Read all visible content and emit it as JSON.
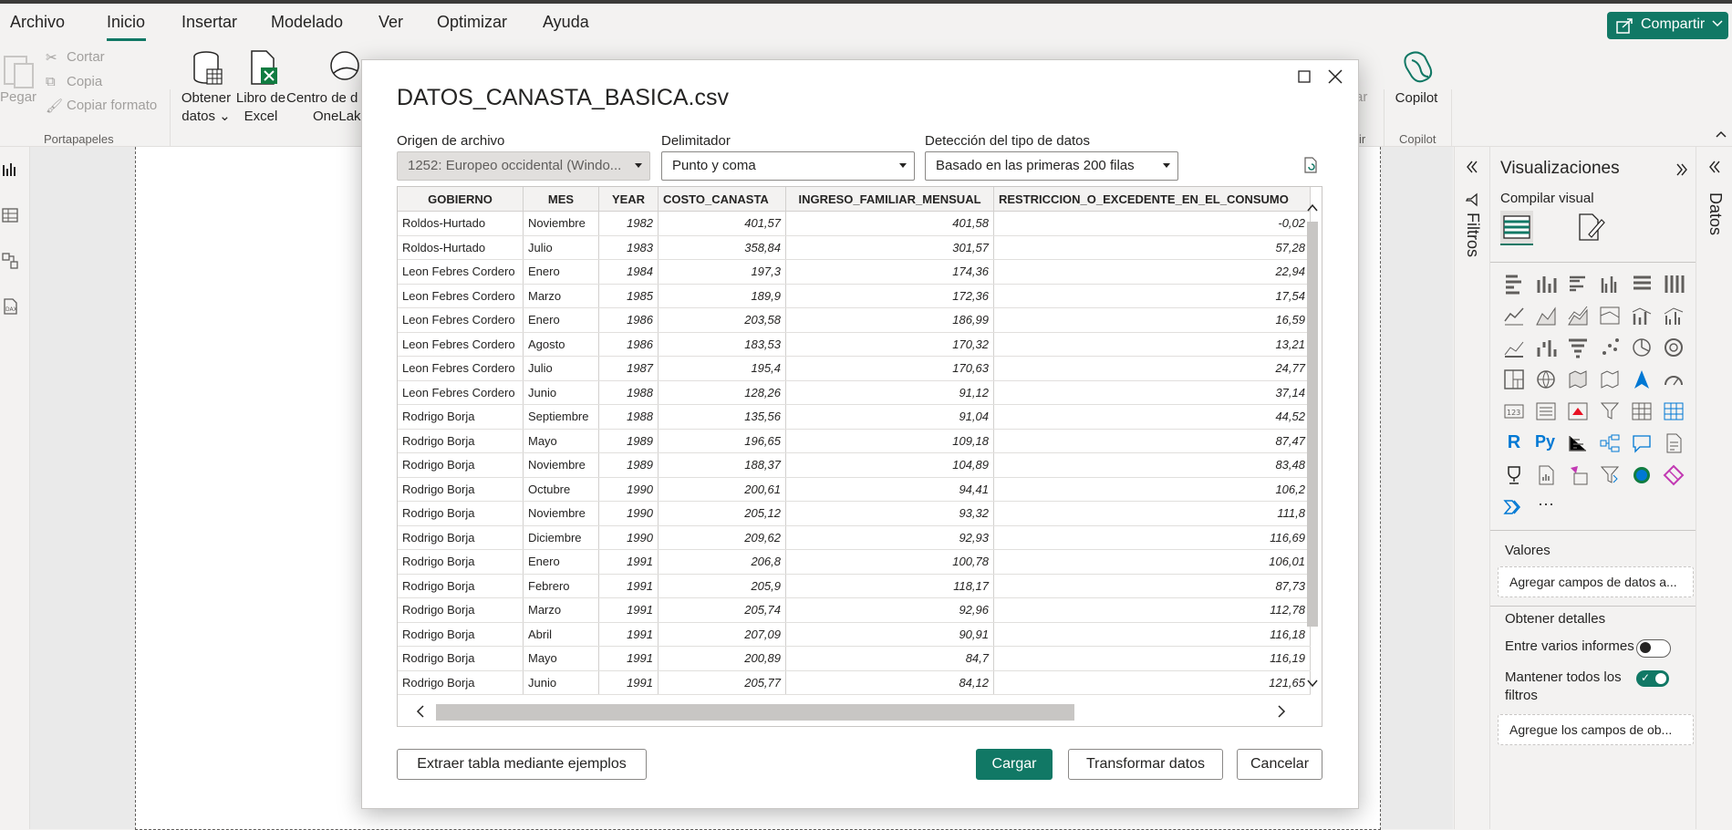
{
  "menu": {
    "items": [
      "Archivo",
      "Inicio",
      "Insertar",
      "Modelado",
      "Ver",
      "Optimizar",
      "Ayuda"
    ],
    "share_label": "Compartir"
  },
  "ribbon": {
    "paste": "Pegar",
    "cut": "Cortar",
    "copy": "Copia",
    "copy_format": "Copiar formato",
    "clipboard_group": "Portapapeles",
    "get_data_1": "Obtener",
    "get_data_2": "datos",
    "excel_1": "Libro de",
    "excel_2": "Excel",
    "onelake_1": "Centro de d",
    "onelake_2": "OneLake",
    "copilot": "Copilot",
    "copilot_group": "Copilot",
    "partial_1": "ar",
    "partial_2": "rtir"
  },
  "panes": {
    "filters": "Filtros",
    "data": "Datos",
    "viz_title": "Visualizaciones",
    "build_visual": "Compilar visual",
    "values_label": "Valores",
    "values_placeholder": "Agregar campos de datos a...",
    "drill_label": "Obtener detalles",
    "cross_report": "Entre varios informes",
    "keep_filters": "Mantener todos los filtros",
    "drill_placeholder": "Agregue los campos de ob...",
    "more": "···"
  },
  "dialog": {
    "title": "DATOS_CANASTA_BASICA.csv",
    "origin_label": "Origen de archivo",
    "origin_value": "1252: Europeo occidental (Windo...",
    "delimiter_label": "Delimitador",
    "delimiter_value": "Punto y coma",
    "detection_label": "Detección del tipo de datos",
    "detection_value": "Basado en las primeras 200 filas",
    "columns": [
      "GOBIERNO",
      "MES",
      "YEAR",
      "COSTO_CANASTA",
      "INGRESO_FAMILIAR_MENSUAL",
      "RESTRICCION_O_EXCEDENTE_EN_EL_CONSUMO"
    ],
    "rows": [
      [
        "Roldos-Hurtado",
        "Noviembre",
        "1982",
        "401,57",
        "401,58",
        "-0,02"
      ],
      [
        "Roldos-Hurtado",
        "Julio",
        "1983",
        "358,84",
        "301,57",
        "57,28"
      ],
      [
        "Leon Febres Cordero",
        "Enero",
        "1984",
        "197,3",
        "174,36",
        "22,94"
      ],
      [
        "Leon Febres Cordero",
        "Marzo",
        "1985",
        "189,9",
        "172,36",
        "17,54"
      ],
      [
        "Leon Febres Cordero",
        "Enero",
        "1986",
        "203,58",
        "186,99",
        "16,59"
      ],
      [
        "Leon Febres Cordero",
        "Agosto",
        "1986",
        "183,53",
        "170,32",
        "13,21"
      ],
      [
        "Leon Febres Cordero",
        "Julio",
        "1987",
        "195,4",
        "170,63",
        "24,77"
      ],
      [
        "Leon Febres Cordero",
        "Junio",
        "1988",
        "128,26",
        "91,12",
        "37,14"
      ],
      [
        "Rodrigo Borja",
        "Septiembre",
        "1988",
        "135,56",
        "91,04",
        "44,52"
      ],
      [
        "Rodrigo Borja",
        "Mayo",
        "1989",
        "196,65",
        "109,18",
        "87,47"
      ],
      [
        "Rodrigo Borja",
        "Noviembre",
        "1989",
        "188,37",
        "104,89",
        "83,48"
      ],
      [
        "Rodrigo Borja",
        "Octubre",
        "1990",
        "200,61",
        "94,41",
        "106,2"
      ],
      [
        "Rodrigo Borja",
        "Noviembre",
        "1990",
        "205,12",
        "93,32",
        "111,8"
      ],
      [
        "Rodrigo Borja",
        "Diciembre",
        "1990",
        "209,62",
        "92,93",
        "116,69"
      ],
      [
        "Rodrigo Borja",
        "Enero",
        "1991",
        "206,8",
        "100,78",
        "106,01"
      ],
      [
        "Rodrigo Borja",
        "Febrero",
        "1991",
        "205,9",
        "118,17",
        "87,73"
      ],
      [
        "Rodrigo Borja",
        "Marzo",
        "1991",
        "205,74",
        "92,96",
        "112,78"
      ],
      [
        "Rodrigo Borja",
        "Abril",
        "1991",
        "207,09",
        "90,91",
        "116,18"
      ],
      [
        "Rodrigo Borja",
        "Mayo",
        "1991",
        "200,89",
        "84,7",
        "116,19"
      ],
      [
        "Rodrigo Borja",
        "Junio",
        "1991",
        "205,77",
        "84,12",
        "121,65"
      ]
    ],
    "btn_extract": "Extraer tabla mediante ejemplos",
    "btn_load": "Cargar",
    "btn_transform": "Transformar datos",
    "btn_cancel": "Cancelar"
  },
  "colors": {
    "accent": "#117865",
    "toolbar_bg": "#f3f2f1",
    "border": "#c8c6c4"
  }
}
